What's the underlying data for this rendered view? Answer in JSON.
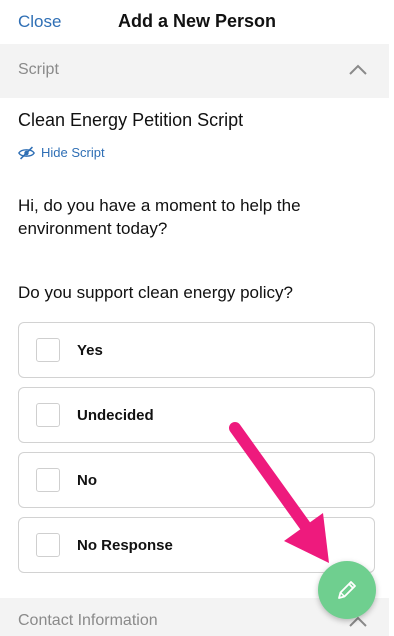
{
  "header": {
    "close_label": "Close",
    "title": "Add a New Person"
  },
  "script_section": {
    "label": "Script"
  },
  "script": {
    "title": "Clean Energy Petition Script",
    "hide_label": "Hide Script",
    "greeting": "Hi, do you have a moment to help the environment today?",
    "question": "Do you support clean energy policy?",
    "options": [
      "Yes",
      "Undecided",
      "No",
      "No Response"
    ]
  },
  "contact_section": {
    "label": "Contact Information"
  },
  "colors": {
    "accent": "#2f6fb5",
    "fab": "#6fcf8f",
    "annotation_arrow": "#ee1a7d"
  },
  "icons": {
    "section_toggle": "chevron-up-icon",
    "hide_script": "eye-slash-icon",
    "fab": "pencil-icon",
    "annotation": "arrow-icon"
  }
}
